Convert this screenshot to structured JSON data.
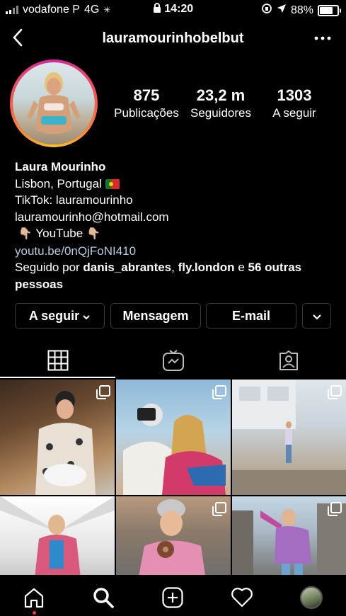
{
  "status_bar": {
    "carrier": "vodafone P",
    "network": "4G",
    "time": "14:20",
    "battery": "88%",
    "battery_level": 0.88
  },
  "nav": {
    "title": "lauramourinhobelbut",
    "back_icon": "chevron-left-icon",
    "more_icon": "ellipsis-icon"
  },
  "profile": {
    "stats": [
      {
        "value": "875",
        "label": "Publicações"
      },
      {
        "value": "23,2 m",
        "label": "Seguidores"
      },
      {
        "value": "1303",
        "label": "A seguir"
      }
    ],
    "name": "Laura Mourinho",
    "location": "Lisbon, Portugal",
    "tiktok": "TikTok: lauramourinho",
    "email": "lauramourinho@hotmail.com",
    "youtube_label": "YouTube",
    "link": "youtu.be/0nQjFoNI410",
    "followed_by_prefix": "Seguido por",
    "followed_by_user1": "danis_abrantes",
    "followed_by_sep": ",",
    "followed_by_user2": "fly.london",
    "followed_by_and": "e",
    "followed_by_rest1": "56 outras",
    "followed_by_rest2": "pessoas"
  },
  "actions": {
    "following_label": "A seguir",
    "message_label": "Mensagem",
    "email_label": "E-mail"
  },
  "tabs": [
    {
      "name": "grid",
      "icon": "grid-icon",
      "active": true
    },
    {
      "name": "igtv",
      "icon": "igtv-icon",
      "active": false
    },
    {
      "name": "tagged",
      "icon": "tagged-icon",
      "active": false
    }
  ],
  "bottom_nav": [
    "home-icon",
    "search-icon",
    "create-icon",
    "activity-icon",
    "profile-avatar"
  ],
  "colors": {
    "link": "#b3cde0",
    "notification_dot": "#ff3040",
    "background": "#000000"
  }
}
